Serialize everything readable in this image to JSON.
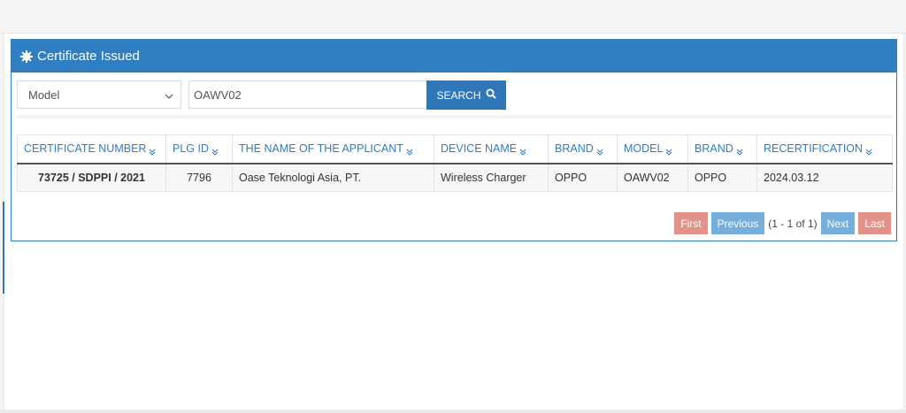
{
  "panel": {
    "title": "Certificate Issued",
    "icon": "gear-icon"
  },
  "filter": {
    "select_value": "Model",
    "search_value": "OAWV02",
    "search_label": "SEARCH"
  },
  "table": {
    "headers": [
      "CERTIFICATE NUMBER",
      "PLG ID",
      "THE NAME OF THE APPLICANT",
      "DEVICE NAME",
      "BRAND",
      "MODEL",
      "BRAND",
      "RECERTIFICATION"
    ],
    "rows": [
      [
        "73725 / SDPPI / 2021",
        "7796",
        "Oase Teknologi Asia, PT.",
        "Wireless Charger",
        "OPPO",
        "OAWV02",
        "OPPO",
        "2024.03.12"
      ]
    ]
  },
  "pager": {
    "first": "First",
    "previous": "Previous",
    "info": "(1 - 1 of 1)",
    "next": "Next",
    "last": "Last"
  },
  "colors": {
    "header_blue": "#2f7ec1",
    "pager_red": "#e3928a",
    "pager_blue": "#76aedc"
  }
}
